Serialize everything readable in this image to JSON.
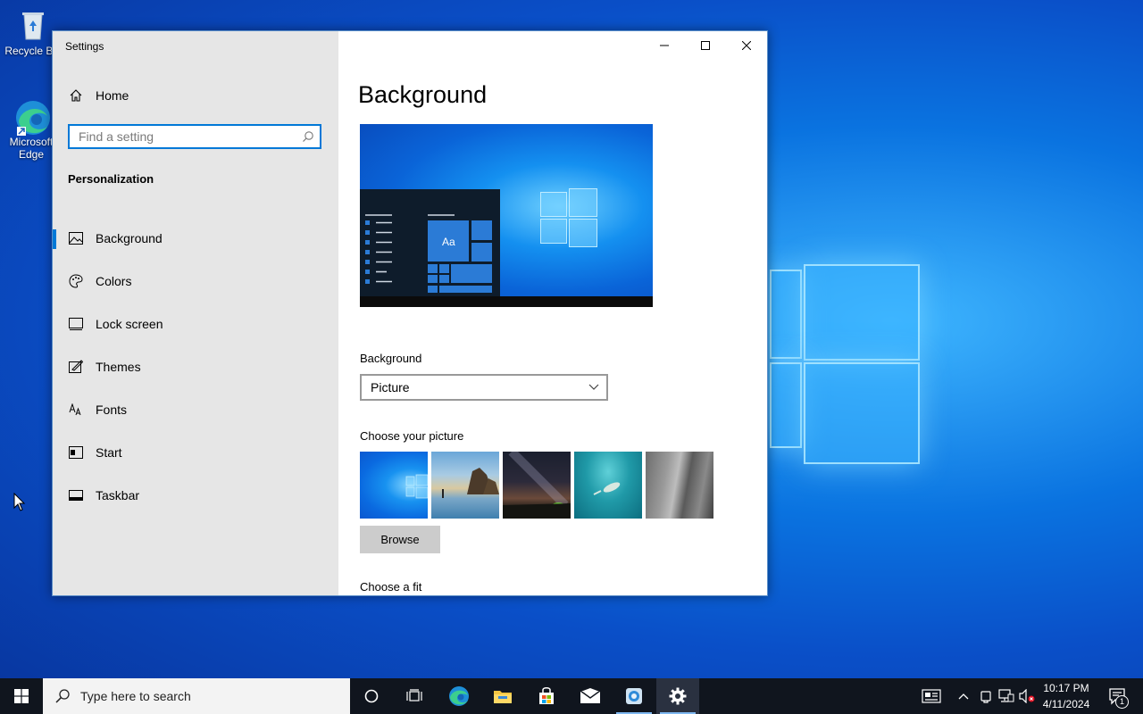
{
  "desktop": {
    "icons": [
      {
        "label": "Recycle Bin"
      },
      {
        "label": "Microsoft Edge"
      }
    ]
  },
  "window": {
    "title": "Settings",
    "sidebar": {
      "home_label": "Home",
      "search_placeholder": "Find a setting",
      "section_title": "Personalization",
      "items": [
        {
          "label": "Background",
          "icon": "picture-icon",
          "active": true
        },
        {
          "label": "Colors",
          "icon": "palette-icon"
        },
        {
          "label": "Lock screen",
          "icon": "lock-screen-icon"
        },
        {
          "label": "Themes",
          "icon": "themes-icon"
        },
        {
          "label": "Fonts",
          "icon": "fonts-icon"
        },
        {
          "label": "Start",
          "icon": "start-icon"
        },
        {
          "label": "Taskbar",
          "icon": "taskbar-icon"
        }
      ]
    },
    "content": {
      "page_title": "Background",
      "preview_tile_text": "Aa",
      "background_label": "Background",
      "background_value": "Picture",
      "choose_picture_label": "Choose your picture",
      "browse_label": "Browse",
      "choose_fit_label": "Choose a fit"
    }
  },
  "taskbar": {
    "search_placeholder": "Type here to search",
    "time": "10:17 PM",
    "date": "4/11/2024",
    "notification_count": "1"
  },
  "colors": {
    "accent": "#0078d7",
    "taskbar": "#10151e",
    "sidebar": "#e6e6e6"
  }
}
